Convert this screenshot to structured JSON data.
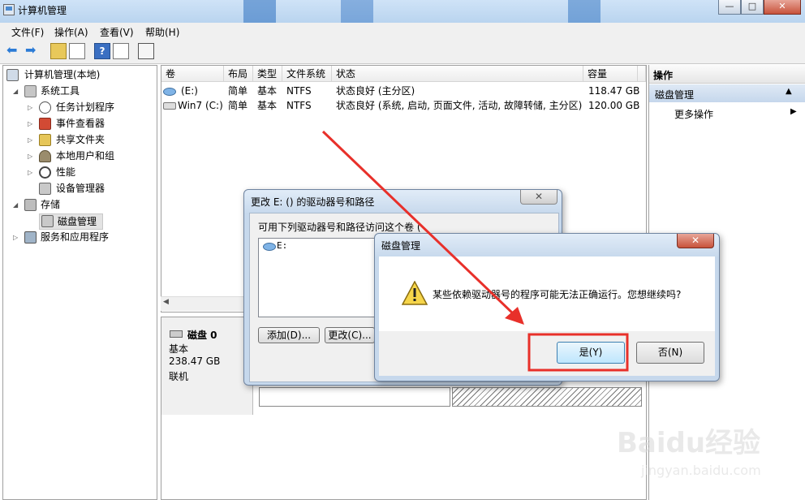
{
  "window": {
    "title": "计算机管理",
    "min_label": "—",
    "max_label": "□",
    "close_label": "✕"
  },
  "menu": [
    "文件(F)",
    "操作(A)",
    "查看(V)",
    "帮助(H)"
  ],
  "tree": {
    "root": "计算机管理(本地)",
    "system_tools": "系统工具",
    "task_scheduler": "任务计划程序",
    "event_viewer": "事件查看器",
    "shared_folders": "共享文件夹",
    "local_users": "本地用户和组",
    "performance": "性能",
    "device_manager": "设备管理器",
    "storage": "存储",
    "disk_management": "磁盘管理",
    "services_apps": "服务和应用程序"
  },
  "volume_table": {
    "headers": [
      "卷",
      "布局",
      "类型",
      "文件系统",
      "状态",
      "容量"
    ],
    "rows": [
      [
        "(E:)",
        "简单",
        "基本",
        "NTFS",
        "状态良好 (主分区)",
        "118.47 GB"
      ],
      [
        "Win7 (C:)",
        "简单",
        "基本",
        "NTFS",
        "状态良好 (系统, 启动, 页面文件, 活动, 故障转储, 主分区)",
        "120.00 GB"
      ]
    ]
  },
  "disk": {
    "name": "磁盘 0",
    "type": "基本",
    "size": "238.47 GB",
    "status": "联机"
  },
  "actions": {
    "header": "操作",
    "section": "磁盘管理",
    "more": "更多操作"
  },
  "change_dialog": {
    "title": "更改 E: () 的驱动器号和路径",
    "label": "可用下列驱动器号和路径访问这个卷 (",
    "item": "E:",
    "add_button": "添加(D)...",
    "change_button": "更改(C)..."
  },
  "confirm_dialog": {
    "title": "磁盘管理",
    "message": "某些依赖驱动器号的程序可能无法正确运行。您想继续吗?",
    "yes_button": "是(Y)",
    "no_button": "否(N)"
  },
  "watermark": {
    "brand": "Baidu经验",
    "url": "jingyan.baidu.com"
  },
  "colors": {
    "accent_red": "#e8302a",
    "selection": "#cfe2f7",
    "title_gradient": "#b9d4ef"
  }
}
